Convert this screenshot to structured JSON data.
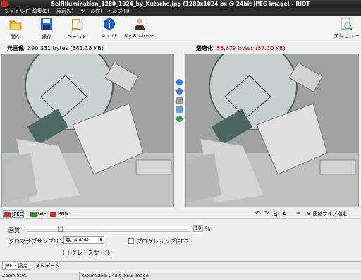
{
  "window": {
    "title": "SelfIllumination_1280_1024_by_Kutsche.jpg (1280x1024 px @ 24bit JPEG image) - RIOT"
  },
  "menu": [
    "ファイル(F)",
    "編集(E)",
    "表示(V)",
    "ツール(T)",
    "ヘルプ(H)"
  ],
  "toolbar": {
    "open": "開く",
    "save": "保存",
    "paste": "ペースト",
    "about": "About",
    "business": "My Business",
    "preview": "プレビュー"
  },
  "original": {
    "label": "元画像",
    "size": "390,331 bytes (381.18 KB)"
  },
  "optimized": {
    "label": "最適化",
    "size": "58,679 bytes (57.30 KB)"
  },
  "formats": [
    "JPEG",
    "GIF",
    "PNG"
  ],
  "compress_button": "圧縮サイズ指定",
  "settings": {
    "quality_label": "画質",
    "quality_value": "19",
    "quality_unit": "%",
    "quality_level": 0.19,
    "chroma_label": "クロマサブサンプリング",
    "chroma_value": "無 (4:4:4)",
    "grayscale_label": "グレースケール",
    "progressive_label": "プログレッシブJPEG"
  },
  "tabs": [
    "JPEG 設定",
    "メタデータ"
  ],
  "status": {
    "zoom": "Zoom 80%",
    "info": "Optimized: 24bit JPEG image"
  },
  "colors": {
    "accent_red": "#c00000",
    "titlebar": "#2a2a2a"
  }
}
